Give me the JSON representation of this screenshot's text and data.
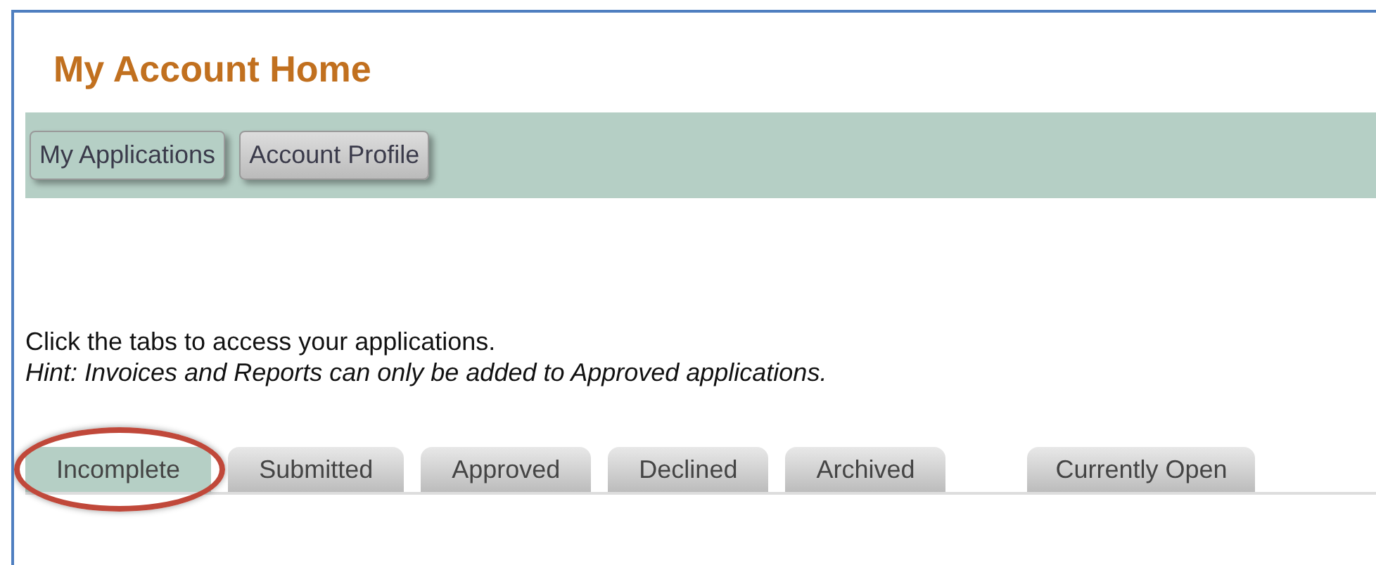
{
  "page": {
    "title": "My Account Home"
  },
  "nav_buttons": [
    {
      "label": "My Applications",
      "selected": true
    },
    {
      "label": "Account Profile",
      "selected": false
    }
  ],
  "instructions": "Click the tabs to access your applications.",
  "hint": "Hint: Invoices and Reports can only be added to Approved applications.",
  "tabs": [
    {
      "label": "Incomplete",
      "selected": true,
      "highlighted": true
    },
    {
      "label": "Submitted",
      "selected": false,
      "highlighted": false
    },
    {
      "label": "Approved",
      "selected": false,
      "highlighted": false
    },
    {
      "label": "Declined",
      "selected": false,
      "highlighted": false
    },
    {
      "label": "Archived",
      "selected": false,
      "highlighted": false
    }
  ],
  "side_tabs": [
    {
      "label": "Currently Open",
      "selected": false,
      "highlighted": false
    }
  ]
}
